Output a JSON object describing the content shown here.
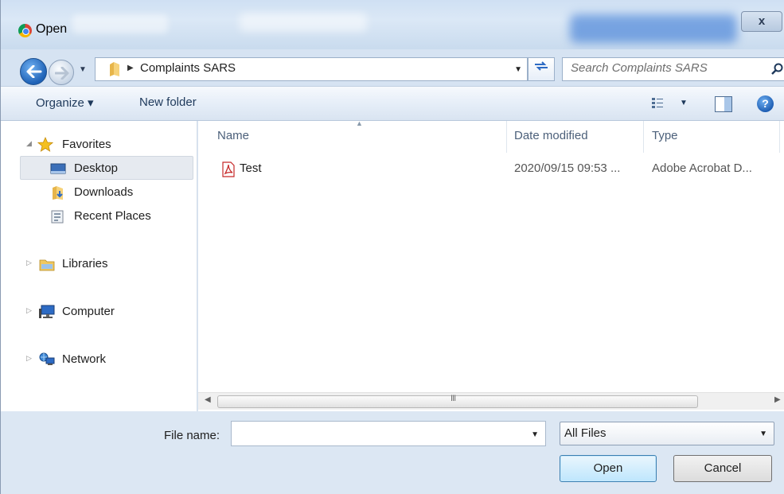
{
  "window": {
    "title": "Open",
    "close_label": "x"
  },
  "address": {
    "path": "Complaints SARS",
    "search_placeholder": "Search Complaints SARS"
  },
  "toolbar": {
    "organize_label": "Organize ▾",
    "new_folder_label": "New folder"
  },
  "nav": {
    "favorites_label": "Favorites",
    "desktop_label": "Desktop",
    "downloads_label": "Downloads",
    "recent_label": "Recent Places",
    "libraries_label": "Libraries",
    "computer_label": "Computer",
    "network_label": "Network"
  },
  "columns": {
    "name": "Name",
    "date": "Date modified",
    "type": "Type"
  },
  "files": [
    {
      "name": "Test",
      "date": "2020/09/15 09:53 ...",
      "type": "Adobe Acrobat D...",
      "icon": "pdf-icon"
    }
  ],
  "scrollbar": {
    "grip": "III"
  },
  "bottom": {
    "file_name_label": "File name:",
    "file_name_value": "",
    "file_type": "All Files",
    "open_label": "Open",
    "cancel_label": "Cancel"
  },
  "colors": {
    "accent": "#1f62b6",
    "selection": "#e6eaf0",
    "chrome": "#d9e4f1"
  }
}
